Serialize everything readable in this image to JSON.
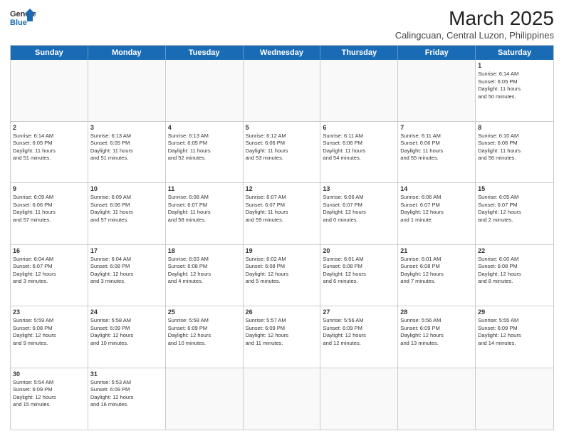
{
  "header": {
    "logo_general": "General",
    "logo_blue": "Blue",
    "month_year": "March 2025",
    "location": "Calingcuan, Central Luzon, Philippines"
  },
  "weekdays": [
    "Sunday",
    "Monday",
    "Tuesday",
    "Wednesday",
    "Thursday",
    "Friday",
    "Saturday"
  ],
  "rows": [
    [
      {
        "day": "",
        "text": ""
      },
      {
        "day": "",
        "text": ""
      },
      {
        "day": "",
        "text": ""
      },
      {
        "day": "",
        "text": ""
      },
      {
        "day": "",
        "text": ""
      },
      {
        "day": "",
        "text": ""
      },
      {
        "day": "1",
        "text": "Sunrise: 6:14 AM\nSunset: 6:05 PM\nDaylight: 11 hours\nand 50 minutes."
      }
    ],
    [
      {
        "day": "2",
        "text": "Sunrise: 6:14 AM\nSunset: 6:05 PM\nDaylight: 11 hours\nand 51 minutes."
      },
      {
        "day": "3",
        "text": "Sunrise: 6:13 AM\nSunset: 6:05 PM\nDaylight: 11 hours\nand 51 minutes."
      },
      {
        "day": "4",
        "text": "Sunrise: 6:13 AM\nSunset: 6:05 PM\nDaylight: 11 hours\nand 52 minutes."
      },
      {
        "day": "5",
        "text": "Sunrise: 6:12 AM\nSunset: 6:06 PM\nDaylight: 11 hours\nand 53 minutes."
      },
      {
        "day": "6",
        "text": "Sunrise: 6:11 AM\nSunset: 6:06 PM\nDaylight: 11 hours\nand 54 minutes."
      },
      {
        "day": "7",
        "text": "Sunrise: 6:11 AM\nSunset: 6:06 PM\nDaylight: 11 hours\nand 55 minutes."
      },
      {
        "day": "8",
        "text": "Sunrise: 6:10 AM\nSunset: 6:06 PM\nDaylight: 11 hours\nand 56 minutes."
      }
    ],
    [
      {
        "day": "9",
        "text": "Sunrise: 6:09 AM\nSunset: 6:06 PM\nDaylight: 11 hours\nand 57 minutes."
      },
      {
        "day": "10",
        "text": "Sunrise: 6:09 AM\nSunset: 6:06 PM\nDaylight: 11 hours\nand 57 minutes."
      },
      {
        "day": "11",
        "text": "Sunrise: 6:08 AM\nSunset: 6:07 PM\nDaylight: 11 hours\nand 58 minutes."
      },
      {
        "day": "12",
        "text": "Sunrise: 6:07 AM\nSunset: 6:07 PM\nDaylight: 11 hours\nand 59 minutes."
      },
      {
        "day": "13",
        "text": "Sunrise: 6:06 AM\nSunset: 6:07 PM\nDaylight: 12 hours\nand 0 minutes."
      },
      {
        "day": "14",
        "text": "Sunrise: 6:06 AM\nSunset: 6:07 PM\nDaylight: 12 hours\nand 1 minute."
      },
      {
        "day": "15",
        "text": "Sunrise: 6:05 AM\nSunset: 6:07 PM\nDaylight: 12 hours\nand 2 minutes."
      }
    ],
    [
      {
        "day": "16",
        "text": "Sunrise: 6:04 AM\nSunset: 6:07 PM\nDaylight: 12 hours\nand 3 minutes."
      },
      {
        "day": "17",
        "text": "Sunrise: 6:04 AM\nSunset: 6:08 PM\nDaylight: 12 hours\nand 3 minutes."
      },
      {
        "day": "18",
        "text": "Sunrise: 6:03 AM\nSunset: 6:08 PM\nDaylight: 12 hours\nand 4 minutes."
      },
      {
        "day": "19",
        "text": "Sunrise: 6:02 AM\nSunset: 6:08 PM\nDaylight: 12 hours\nand 5 minutes."
      },
      {
        "day": "20",
        "text": "Sunrise: 6:01 AM\nSunset: 6:08 PM\nDaylight: 12 hours\nand 6 minutes."
      },
      {
        "day": "21",
        "text": "Sunrise: 6:01 AM\nSunset: 6:08 PM\nDaylight: 12 hours\nand 7 minutes."
      },
      {
        "day": "22",
        "text": "Sunrise: 6:00 AM\nSunset: 6:08 PM\nDaylight: 12 hours\nand 8 minutes."
      }
    ],
    [
      {
        "day": "23",
        "text": "Sunrise: 5:59 AM\nSunset: 6:08 PM\nDaylight: 12 hours\nand 9 minutes."
      },
      {
        "day": "24",
        "text": "Sunrise: 5:58 AM\nSunset: 6:09 PM\nDaylight: 12 hours\nand 10 minutes."
      },
      {
        "day": "25",
        "text": "Sunrise: 5:58 AM\nSunset: 6:09 PM\nDaylight: 12 hours\nand 10 minutes."
      },
      {
        "day": "26",
        "text": "Sunrise: 5:57 AM\nSunset: 6:09 PM\nDaylight: 12 hours\nand 11 minutes."
      },
      {
        "day": "27",
        "text": "Sunrise: 5:56 AM\nSunset: 6:09 PM\nDaylight: 12 hours\nand 12 minutes."
      },
      {
        "day": "28",
        "text": "Sunrise: 5:56 AM\nSunset: 6:09 PM\nDaylight: 12 hours\nand 13 minutes."
      },
      {
        "day": "29",
        "text": "Sunrise: 5:55 AM\nSunset: 6:09 PM\nDaylight: 12 hours\nand 14 minutes."
      }
    ],
    [
      {
        "day": "30",
        "text": "Sunrise: 5:54 AM\nSunset: 6:09 PM\nDaylight: 12 hours\nand 15 minutes."
      },
      {
        "day": "31",
        "text": "Sunrise: 5:53 AM\nSunset: 6:09 PM\nDaylight: 12 hours\nand 16 minutes."
      },
      {
        "day": "",
        "text": ""
      },
      {
        "day": "",
        "text": ""
      },
      {
        "day": "",
        "text": ""
      },
      {
        "day": "",
        "text": ""
      },
      {
        "day": "",
        "text": ""
      }
    ]
  ]
}
